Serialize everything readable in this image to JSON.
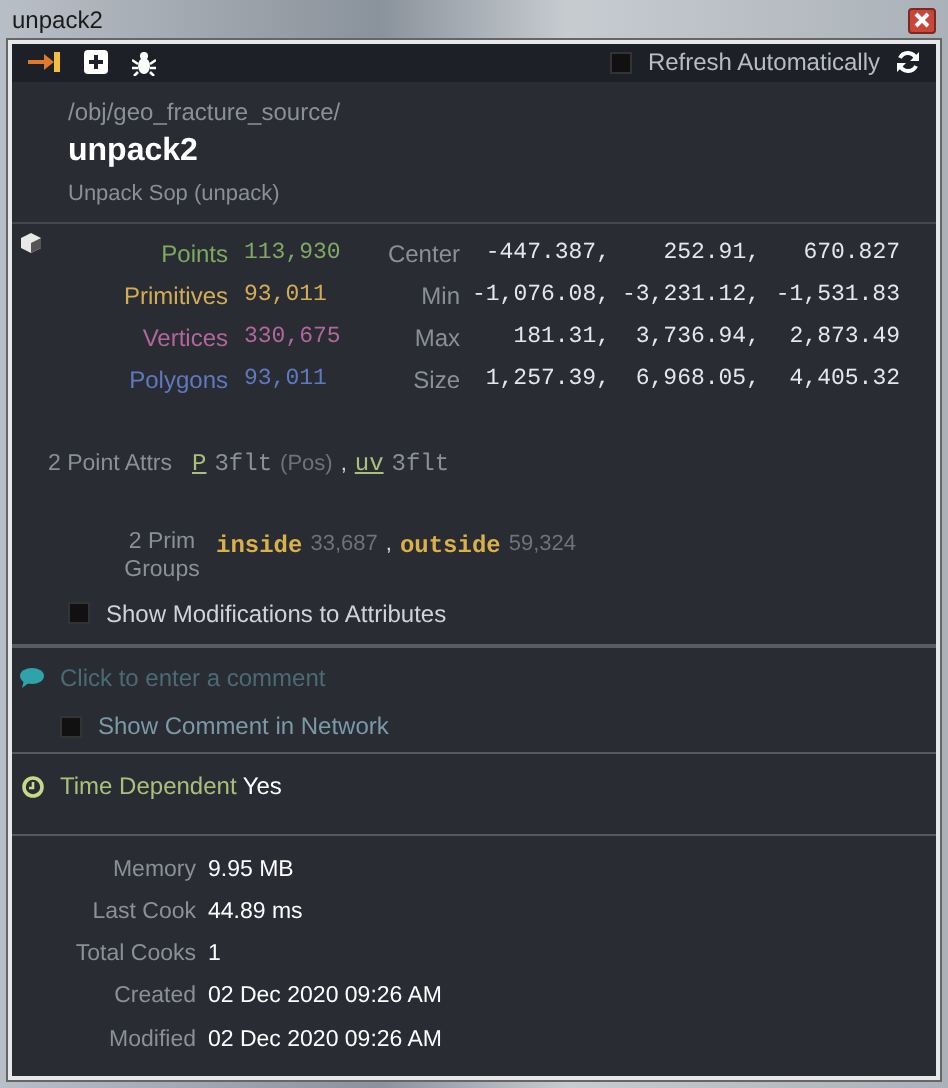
{
  "window": {
    "title": "unpack2"
  },
  "toolbar": {
    "refresh": {
      "label": "Refresh Automatically",
      "checked": false
    }
  },
  "node": {
    "path": "/obj/geo_fracture_source/",
    "name": "unpack2",
    "type": "Unpack Sop (unpack)"
  },
  "counts": [
    {
      "label": "Points",
      "value": "113,930",
      "color": "#7fa862"
    },
    {
      "label": "Primitives",
      "value": "93,011",
      "color": "#d2ad55"
    },
    {
      "label": "Vertices",
      "value": "330,675",
      "color": "#b0679b"
    },
    {
      "label": "Polygons",
      "value": "93,011",
      "color": "#5f79bd"
    }
  ],
  "bounds": [
    {
      "label": "Center",
      "values": [
        "-447.387,",
        "252.91,",
        "670.827"
      ]
    },
    {
      "label": "Min",
      "values": [
        "-1,076.08,",
        "-3,231.12,",
        "-1,531.83"
      ]
    },
    {
      "label": "Max",
      "values": [
        "181.31,",
        "3,736.94,",
        "2,873.49"
      ]
    },
    {
      "label": "Size",
      "values": [
        "1,257.39,",
        "6,968.05,",
        "4,405.32"
      ]
    }
  ],
  "point_attrs": {
    "label": "2 Point Attrs",
    "separator": ",",
    "attrs": [
      {
        "name": "P",
        "type": "3flt",
        "note": "(Pos)"
      },
      {
        "name": "uv",
        "type": "3flt"
      }
    ]
  },
  "prim_groups": {
    "label": "2 Prim Groups",
    "separator": ",",
    "groups": [
      {
        "name": "inside",
        "count": "33,687"
      },
      {
        "name": "outside",
        "count": "59,324"
      }
    ]
  },
  "show_modifications": {
    "label": "Show Modifications to Attributes",
    "checked": false
  },
  "comment": {
    "placeholder": "Click to enter a comment"
  },
  "show_comment": {
    "label": "Show Comment in Network",
    "checked": false
  },
  "time_dependent": {
    "label": "Time Dependent",
    "value": "Yes"
  },
  "stats": [
    {
      "label": "Memory",
      "value": "9.95 MB"
    },
    {
      "label": "Last Cook",
      "value": "44.89 ms"
    },
    {
      "label": "Total Cooks",
      "value": "1"
    },
    {
      "label": "Created",
      "value": "02 Dec 2020 09:26 AM"
    },
    {
      "label": "Modified",
      "value": "02 Dec 2020 09:26 AM"
    }
  ]
}
